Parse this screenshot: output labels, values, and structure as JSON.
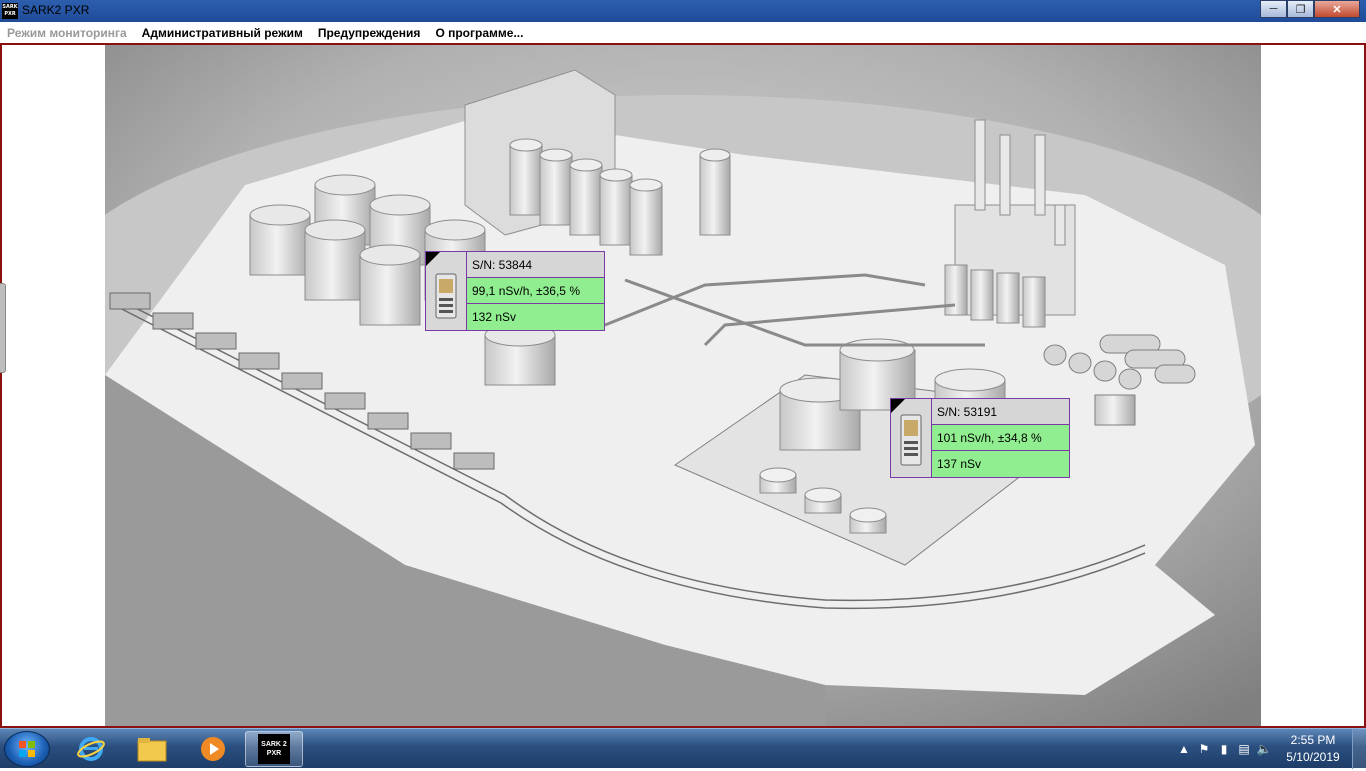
{
  "window": {
    "title": "SARK2 PXR",
    "app_icon_text": "SARK 2 PXR"
  },
  "menu": {
    "items": [
      {
        "label": "Режим мониторинга",
        "disabled": true
      },
      {
        "label": "Административный режим",
        "disabled": false
      },
      {
        "label": "Предупреждения",
        "disabled": false
      },
      {
        "label": "О программе...",
        "disabled": false
      }
    ]
  },
  "detectors": [
    {
      "serial": "S/N: 53844",
      "rate": "99,1 nSv/h, ±36,5 %",
      "dose": "132 nSv",
      "status_color": "#90ee90"
    },
    {
      "serial": "S/N: 53191",
      "rate": "101 nSv/h, ±34,8 %",
      "dose": "137 nSv",
      "status_color": "#90ee90"
    }
  ],
  "taskbar": {
    "pinned": [
      "start-orb",
      "internet-explorer-icon",
      "file-explorer-icon",
      "media-player-icon",
      "sark2-pxr-app"
    ],
    "active_app_label": "SARK 2 PXR"
  },
  "tray": {
    "time": "2:55 PM",
    "date": "5/10/2019"
  },
  "colors": {
    "frame_border": "#8b1010",
    "card_border": "#7a3aa6",
    "status_ok": "#90ee90",
    "serial_bg": "#d6d6d6"
  }
}
